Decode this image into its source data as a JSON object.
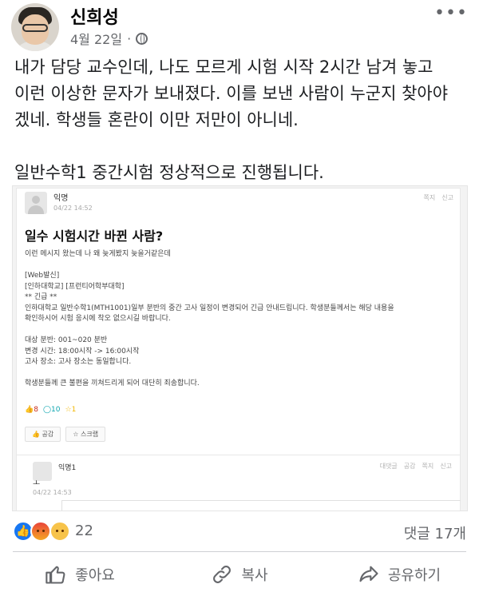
{
  "post": {
    "author": "신희성",
    "date": "4월 22일",
    "dot": "·",
    "more": "•••",
    "text_lines": [
      "내가 담당 교수인데, 나도 모르게 시험 시작 2시간 남겨 놓고",
      "이런 이상한 문자가 보내졌다. 이를 보낸 사람이 누군지 찾아야",
      "겠네. 학생들 혼란이 이만 저만이 아니네.",
      "일반수학1 중간시험 정상적으로 진행됩니다."
    ]
  },
  "embedded": {
    "author": "익명",
    "date": "04/22 14:52",
    "actions": [
      "쪽지",
      "신고"
    ],
    "title": "일수 시험시간 바뀐 사람?",
    "body": [
      "이런 메시지 왔는데 나 왜 늦게봤지 늦을거같은데",
      "[Web발신]",
      "[인하대학교] [프런티어학부대학]",
      "** 긴급 **",
      "인하대학교 일반수학1(MTH1001)일부 분반의 중간 고사 일정이 변경되어 긴급 안내드립니다. 학생분들께서는 해당 내용을",
      "확인하시어 시험 응시에 착오 없으시길 바랍니다.",
      "대상 분반: 001~020 분반",
      "변경 시간: 18:00시작 -> 16:00시작",
      "고사 장소: 고사 장소는 동일합니다.",
      "학생분들께 큰 불편을 끼쳐드리게 되어 대단히 죄송합니다."
    ],
    "likes": "8",
    "comments": "10",
    "scraps": "1",
    "like_button": "공감",
    "scrap_button": "스크랩",
    "comment": {
      "author": "익명1",
      "actions": [
        "대댓글",
        "공감",
        "쪽지",
        "신고"
      ],
      "text": "ㅗ",
      "date": "04/22 14:53"
    }
  },
  "footer": {
    "reaction_count": "22",
    "comment_count": "댓글 17개",
    "like_label": "좋아요",
    "copy_label": "복사",
    "share_label": "공유하기"
  },
  "colors": {
    "accent": "#1877f2",
    "muted": "#65676b",
    "text": "#1c1e21"
  }
}
